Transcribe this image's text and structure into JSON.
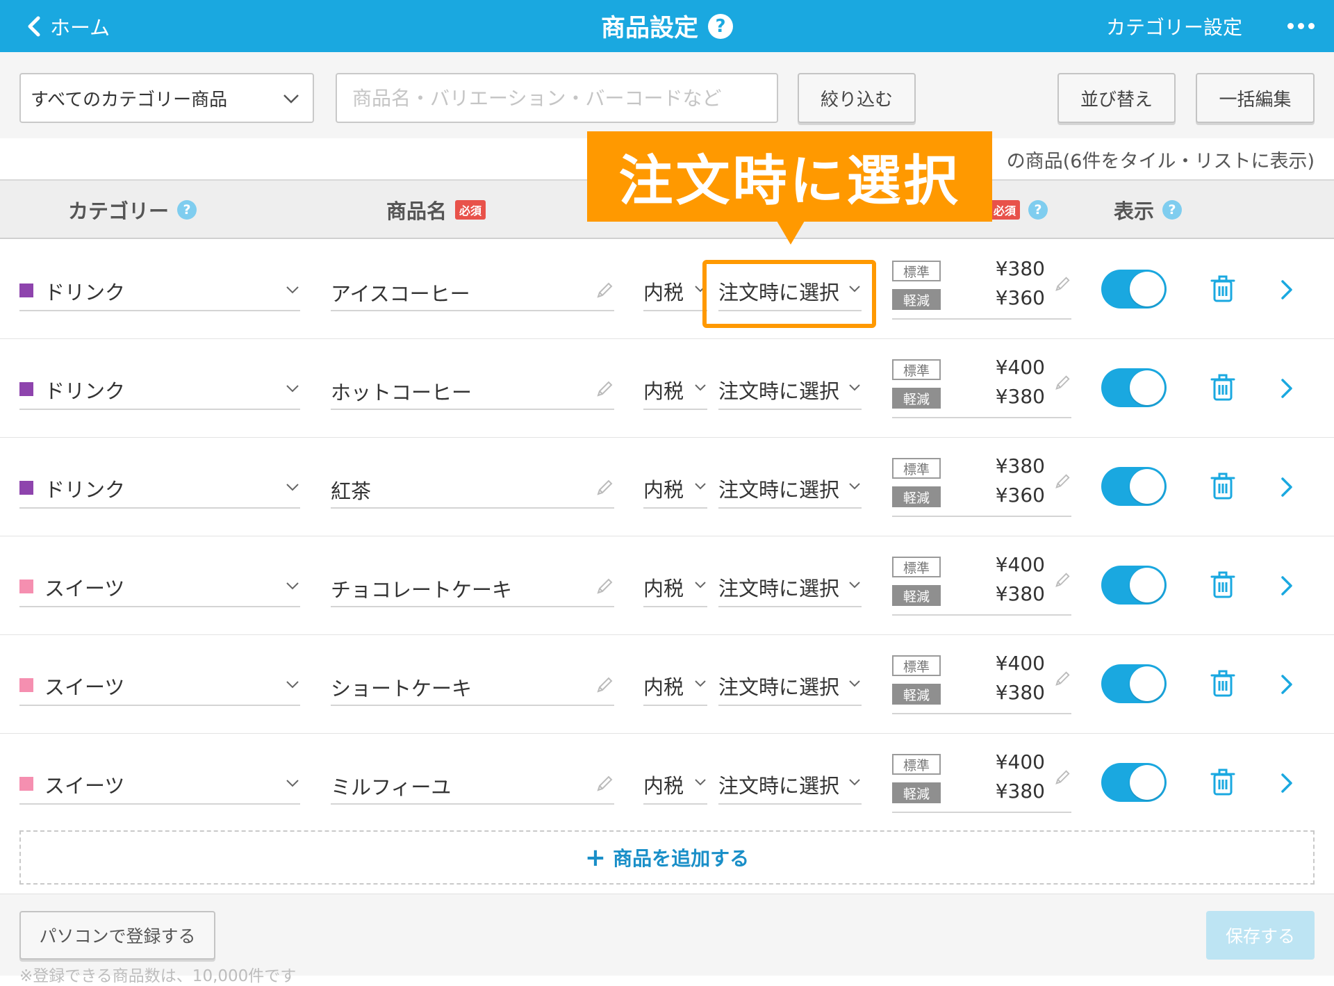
{
  "header": {
    "back_label": "ホーム",
    "title": "商品設定",
    "help": "?",
    "category_setting": "カテゴリー設定"
  },
  "toolbar": {
    "category_select": "すべてのカテゴリー商品",
    "search_placeholder": "商品名・バリエーション・バーコードなど",
    "filter_label": "絞り込む",
    "sort_label": "並び替え",
    "bulk_edit_label": "一括編集"
  },
  "count_text": "の商品(6件をタイル・リストに表示)",
  "table_header": {
    "category": "カテゴリー",
    "product_name": "商品名",
    "required": "必須",
    "price_required": "必須",
    "display": "表示",
    "help": "?"
  },
  "rows": [
    {
      "category": "ドリンク",
      "category_color": "#8e44ad",
      "name": "アイスコーヒー",
      "tax": "内税",
      "rate": "注文時に選択",
      "std_label": "標準",
      "red_label": "軽減",
      "price_std": "¥380",
      "price_red": "¥360",
      "visible": true
    },
    {
      "category": "ドリンク",
      "category_color": "#8e44ad",
      "name": "ホットコーヒー",
      "tax": "内税",
      "rate": "注文時に選択",
      "std_label": "標準",
      "red_label": "軽減",
      "price_std": "¥400",
      "price_red": "¥380",
      "visible": true
    },
    {
      "category": "ドリンク",
      "category_color": "#8e44ad",
      "name": "紅茶",
      "tax": "内税",
      "rate": "注文時に選択",
      "std_label": "標準",
      "red_label": "軽減",
      "price_std": "¥380",
      "price_red": "¥360",
      "visible": true
    },
    {
      "category": "スイーツ",
      "category_color": "#f58fb0",
      "name": "チョコレートケーキ",
      "tax": "内税",
      "rate": "注文時に選択",
      "std_label": "標準",
      "red_label": "軽減",
      "price_std": "¥400",
      "price_red": "¥380",
      "visible": true
    },
    {
      "category": "スイーツ",
      "category_color": "#f58fb0",
      "name": "ショートケーキ",
      "tax": "内税",
      "rate": "注文時に選択",
      "std_label": "標準",
      "red_label": "軽減",
      "price_std": "¥400",
      "price_red": "¥380",
      "visible": true
    },
    {
      "category": "スイーツ",
      "category_color": "#f58fb0",
      "name": "ミルフィーユ",
      "tax": "内税",
      "rate": "注文時に選択",
      "std_label": "標準",
      "red_label": "軽減",
      "price_std": "¥400",
      "price_red": "¥380",
      "visible": true
    }
  ],
  "add_product_label": "商品を追加する",
  "footer": {
    "pc_register_label": "パソコンで登録する",
    "save_label": "保存する",
    "note": "※登録できる商品数は、10,000件です"
  },
  "callout": "注文時に選択",
  "colors": {
    "accent": "#1aa8e0",
    "callout": "#ff9900",
    "drink": "#8e44ad",
    "sweets": "#f58fb0"
  }
}
